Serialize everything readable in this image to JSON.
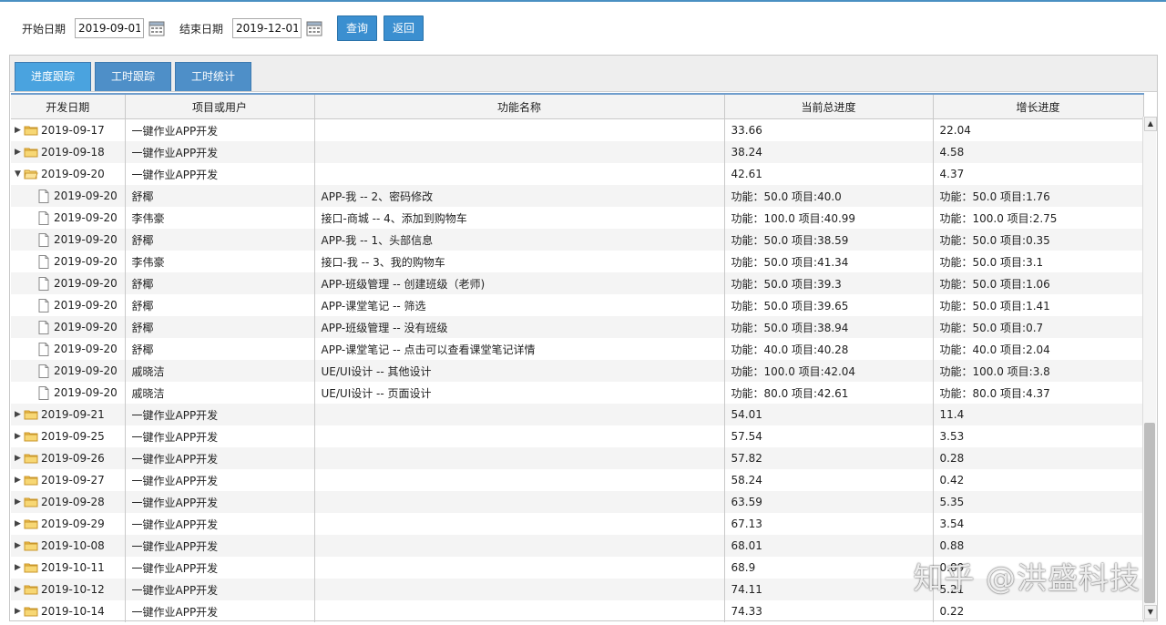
{
  "filter": {
    "start_label": "开始日期",
    "start_value": "2019-09-01",
    "end_label": "结束日期",
    "end_value": "2019-12-01",
    "query_label": "查询",
    "back_label": "返回"
  },
  "tabs": [
    {
      "label": "进度跟踪",
      "active": true
    },
    {
      "label": "工时跟踪",
      "active": false
    },
    {
      "label": "工时统计",
      "active": false
    }
  ],
  "columns": [
    "开发日期",
    "项目或用户",
    "功能名称",
    "当前总进度",
    "增长进度"
  ],
  "rows": [
    {
      "type": "folder",
      "expanded": false,
      "date": "2019-09-17",
      "user": "一键作业APP开发",
      "feature": "",
      "total": "33.66",
      "growth": "22.04"
    },
    {
      "type": "folder",
      "expanded": false,
      "date": "2019-09-18",
      "user": "一键作业APP开发",
      "feature": "",
      "total": "38.24",
      "growth": "4.58"
    },
    {
      "type": "folder",
      "expanded": true,
      "date": "2019-09-20",
      "user": "一键作业APP开发",
      "feature": "",
      "total": "42.61",
      "growth": "4.37"
    },
    {
      "type": "doc",
      "date": "2019-09-20",
      "user": "舒椰",
      "feature": "APP-我 -- 2、密码修改",
      "total": "功能：50.0 项目:40.0",
      "growth": "功能：50.0 项目:1.76"
    },
    {
      "type": "doc",
      "date": "2019-09-20",
      "user": "李伟豪",
      "feature": "接口-商城 -- 4、添加到购物车",
      "total": "功能：100.0 项目:40.99",
      "growth": "功能：100.0 项目:2.75"
    },
    {
      "type": "doc",
      "date": "2019-09-20",
      "user": "舒椰",
      "feature": "APP-我 -- 1、头部信息",
      "total": "功能：50.0 项目:38.59",
      "growth": "功能：50.0 项目:0.35"
    },
    {
      "type": "doc",
      "date": "2019-09-20",
      "user": "李伟豪",
      "feature": "接口-我 -- 3、我的购物车",
      "total": "功能：50.0 项目:41.34",
      "growth": "功能：50.0 项目:3.1"
    },
    {
      "type": "doc",
      "date": "2019-09-20",
      "user": "舒椰",
      "feature": "APP-班级管理 -- 创建班级（老师)",
      "total": "功能：50.0 项目:39.3",
      "growth": "功能：50.0 项目:1.06"
    },
    {
      "type": "doc",
      "date": "2019-09-20",
      "user": "舒椰",
      "feature": "APP-课堂笔记 -- 筛选",
      "total": "功能：50.0 项目:39.65",
      "growth": "功能：50.0 项目:1.41"
    },
    {
      "type": "doc",
      "date": "2019-09-20",
      "user": "舒椰",
      "feature": "APP-班级管理 -- 没有班级",
      "total": "功能：50.0 项目:38.94",
      "growth": "功能：50.0 项目:0.7"
    },
    {
      "type": "doc",
      "date": "2019-09-20",
      "user": "舒椰",
      "feature": "APP-课堂笔记 -- 点击可以查看课堂笔记详情",
      "total": "功能：40.0 项目:40.28",
      "growth": "功能：40.0 项目:2.04"
    },
    {
      "type": "doc",
      "date": "2019-09-20",
      "user": "戚晓洁",
      "feature": "UE/UI设计 -- 其他设计",
      "total": "功能：100.0 项目:42.04",
      "growth": "功能：100.0 项目:3.8"
    },
    {
      "type": "doc",
      "date": "2019-09-20",
      "user": "戚晓洁",
      "feature": "UE/UI设计 -- 页面设计",
      "total": "功能：80.0 项目:42.61",
      "growth": "功能：80.0 项目:4.37"
    },
    {
      "type": "folder",
      "expanded": false,
      "date": "2019-09-21",
      "user": "一键作业APP开发",
      "feature": "",
      "total": "54.01",
      "growth": "11.4"
    },
    {
      "type": "folder",
      "expanded": false,
      "date": "2019-09-25",
      "user": "一键作业APP开发",
      "feature": "",
      "total": "57.54",
      "growth": "3.53"
    },
    {
      "type": "folder",
      "expanded": false,
      "date": "2019-09-26",
      "user": "一键作业APP开发",
      "feature": "",
      "total": "57.82",
      "growth": "0.28"
    },
    {
      "type": "folder",
      "expanded": false,
      "date": "2019-09-27",
      "user": "一键作业APP开发",
      "feature": "",
      "total": "58.24",
      "growth": "0.42"
    },
    {
      "type": "folder",
      "expanded": false,
      "date": "2019-09-28",
      "user": "一键作业APP开发",
      "feature": "",
      "total": "63.59",
      "growth": "5.35"
    },
    {
      "type": "folder",
      "expanded": false,
      "date": "2019-09-29",
      "user": "一键作业APP开发",
      "feature": "",
      "total": "67.13",
      "growth": "3.54"
    },
    {
      "type": "folder",
      "expanded": false,
      "date": "2019-10-08",
      "user": "一键作业APP开发",
      "feature": "",
      "total": "68.01",
      "growth": "0.88"
    },
    {
      "type": "folder",
      "expanded": false,
      "date": "2019-10-11",
      "user": "一键作业APP开发",
      "feature": "",
      "total": "68.9",
      "growth": "0.89"
    },
    {
      "type": "folder",
      "expanded": false,
      "date": "2019-10-12",
      "user": "一键作业APP开发",
      "feature": "",
      "total": "74.11",
      "growth": "5.21"
    },
    {
      "type": "folder",
      "expanded": false,
      "date": "2019-10-14",
      "user": "一键作业APP开发",
      "feature": "",
      "total": "74.33",
      "growth": "0.22"
    }
  ],
  "watermark": "知乎 @洪盛科技",
  "colors": {
    "accent": "#3b8fd0",
    "tab": "#4e8fc8",
    "tab_active": "#4aa3df",
    "folder": "#f2c14e"
  }
}
